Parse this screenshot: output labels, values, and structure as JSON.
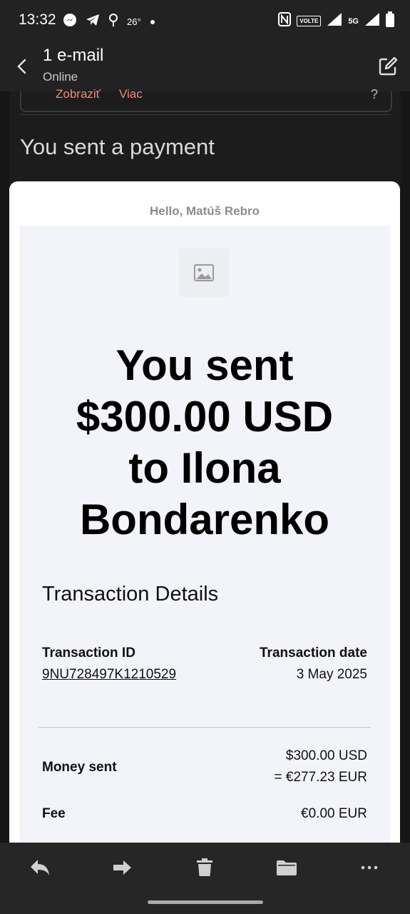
{
  "status_bar": {
    "time": "13:32",
    "temperature": "26°",
    "network": "5G",
    "volte": "VOLTE",
    "icons_left": [
      "messenger-icon",
      "telegram-icon",
      "location-pin-icon",
      "dot-icon"
    ],
    "icons_right": [
      "nfc-icon",
      "volte-icon",
      "signal-icon",
      "battery-icon"
    ]
  },
  "header": {
    "title": "1 e-mail",
    "subtitle": "Online"
  },
  "banner": {
    "show_label": "Zobraziť",
    "more_label": "Viac",
    "help_label": "?"
  },
  "email": {
    "subject": "You sent a payment",
    "greeting": "Hello, Matúš Rebro",
    "headline_lines": [
      "You sent",
      "$300.00 USD",
      "to Ilona",
      "Bondarenko"
    ],
    "details_title": "Transaction Details",
    "transaction_id_label": "Transaction ID",
    "transaction_id": "9NU728497K1210529",
    "transaction_date_label": "Transaction date",
    "transaction_date": "3 May 2025",
    "money_sent_label": "Money sent",
    "money_sent_usd": "$300.00 USD",
    "money_sent_eur": "= €277.23 EUR",
    "fee_label": "Fee",
    "fee_value": "€0.00 EUR"
  },
  "toolbar": {
    "actions": [
      "reply",
      "forward",
      "delete",
      "move-to-folder",
      "more"
    ]
  },
  "colors": {
    "accent_link": "#f08a7e",
    "background_dark": "#161616",
    "card_inner": "#f3f4f9"
  }
}
